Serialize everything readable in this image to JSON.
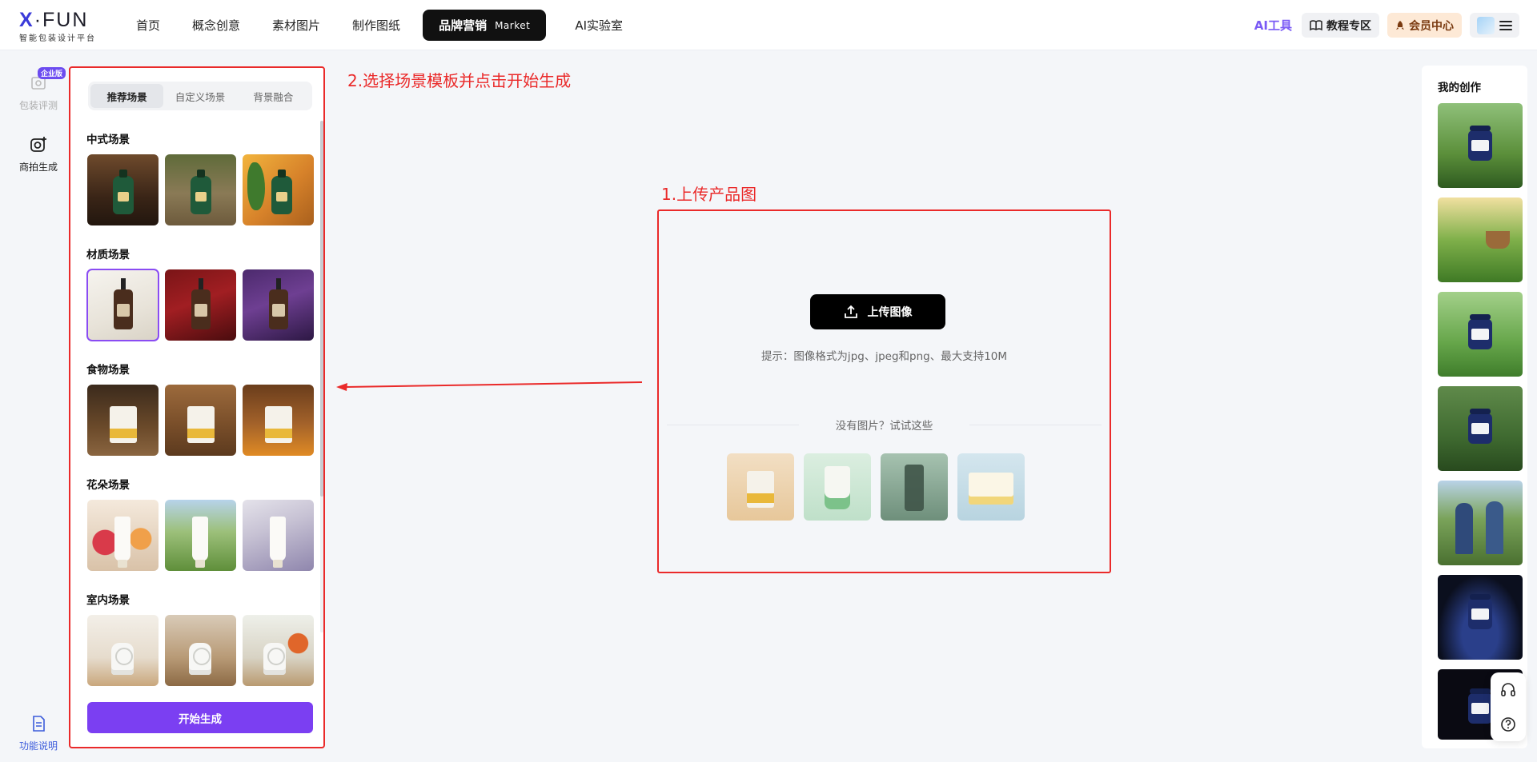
{
  "logo": {
    "mark_x": "X",
    "mark_rest": "·FUN",
    "subtitle": "智能包装设计平台"
  },
  "nav": {
    "items": [
      {
        "label": "首页"
      },
      {
        "label": "概念创意"
      },
      {
        "label": "素材图片"
      },
      {
        "label": "制作图纸"
      },
      {
        "label": "品牌营销",
        "tag": "Market",
        "active": true
      },
      {
        "label": "AI实验室"
      }
    ]
  },
  "top_right": {
    "ai_tools": "AI工具",
    "tutorial": "教程专区",
    "member": "会员中心"
  },
  "rail": {
    "package_review": {
      "label": "包装评测",
      "badge": "企业版"
    },
    "product_shot": {
      "label": "商拍生成"
    },
    "help": {
      "label": "功能说明"
    }
  },
  "panel": {
    "tabs": [
      {
        "label": "推荐场景",
        "active": true
      },
      {
        "label": "自定义场景"
      },
      {
        "label": "背景融合"
      }
    ],
    "sections": [
      {
        "title": "中式场景"
      },
      {
        "title": "材质场景"
      },
      {
        "title": "食物场景"
      },
      {
        "title": "花朵场景"
      },
      {
        "title": "室内场景"
      }
    ],
    "generate_button": "开始生成"
  },
  "annotations": {
    "step2": "2.选择场景模板并点击开始生成",
    "step1": "1.上传产品图"
  },
  "upload": {
    "button": "上传图像",
    "tip": "提示：图像格式为jpg、jpeg和png、最大支持10M",
    "try_these": "没有图片？试试这些"
  },
  "my_works": {
    "title": "我的创作"
  },
  "colors": {
    "accent": "#7b3ff2",
    "annotation_red": "#ea2a2a",
    "active_nav": "#111111"
  }
}
